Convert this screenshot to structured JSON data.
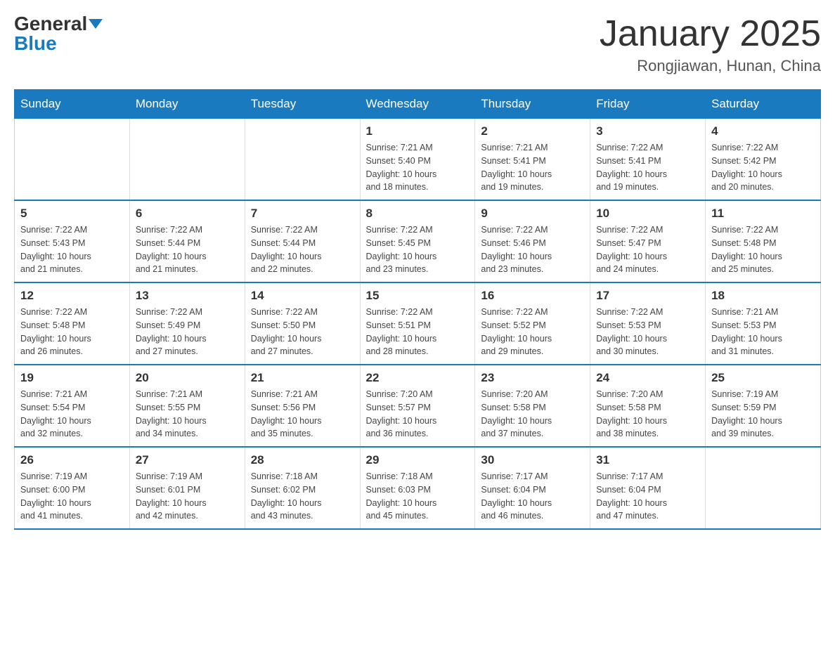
{
  "header": {
    "logo_general": "General",
    "logo_blue": "Blue",
    "title": "January 2025",
    "subtitle": "Rongjiawan, Hunan, China"
  },
  "days_of_week": [
    "Sunday",
    "Monday",
    "Tuesday",
    "Wednesday",
    "Thursday",
    "Friday",
    "Saturday"
  ],
  "weeks": [
    [
      {
        "day": "",
        "info": ""
      },
      {
        "day": "",
        "info": ""
      },
      {
        "day": "",
        "info": ""
      },
      {
        "day": "1",
        "info": "Sunrise: 7:21 AM\nSunset: 5:40 PM\nDaylight: 10 hours\nand 18 minutes."
      },
      {
        "day": "2",
        "info": "Sunrise: 7:21 AM\nSunset: 5:41 PM\nDaylight: 10 hours\nand 19 minutes."
      },
      {
        "day": "3",
        "info": "Sunrise: 7:22 AM\nSunset: 5:41 PM\nDaylight: 10 hours\nand 19 minutes."
      },
      {
        "day": "4",
        "info": "Sunrise: 7:22 AM\nSunset: 5:42 PM\nDaylight: 10 hours\nand 20 minutes."
      }
    ],
    [
      {
        "day": "5",
        "info": "Sunrise: 7:22 AM\nSunset: 5:43 PM\nDaylight: 10 hours\nand 21 minutes."
      },
      {
        "day": "6",
        "info": "Sunrise: 7:22 AM\nSunset: 5:44 PM\nDaylight: 10 hours\nand 21 minutes."
      },
      {
        "day": "7",
        "info": "Sunrise: 7:22 AM\nSunset: 5:44 PM\nDaylight: 10 hours\nand 22 minutes."
      },
      {
        "day": "8",
        "info": "Sunrise: 7:22 AM\nSunset: 5:45 PM\nDaylight: 10 hours\nand 23 minutes."
      },
      {
        "day": "9",
        "info": "Sunrise: 7:22 AM\nSunset: 5:46 PM\nDaylight: 10 hours\nand 23 minutes."
      },
      {
        "day": "10",
        "info": "Sunrise: 7:22 AM\nSunset: 5:47 PM\nDaylight: 10 hours\nand 24 minutes."
      },
      {
        "day": "11",
        "info": "Sunrise: 7:22 AM\nSunset: 5:48 PM\nDaylight: 10 hours\nand 25 minutes."
      }
    ],
    [
      {
        "day": "12",
        "info": "Sunrise: 7:22 AM\nSunset: 5:48 PM\nDaylight: 10 hours\nand 26 minutes."
      },
      {
        "day": "13",
        "info": "Sunrise: 7:22 AM\nSunset: 5:49 PM\nDaylight: 10 hours\nand 27 minutes."
      },
      {
        "day": "14",
        "info": "Sunrise: 7:22 AM\nSunset: 5:50 PM\nDaylight: 10 hours\nand 27 minutes."
      },
      {
        "day": "15",
        "info": "Sunrise: 7:22 AM\nSunset: 5:51 PM\nDaylight: 10 hours\nand 28 minutes."
      },
      {
        "day": "16",
        "info": "Sunrise: 7:22 AM\nSunset: 5:52 PM\nDaylight: 10 hours\nand 29 minutes."
      },
      {
        "day": "17",
        "info": "Sunrise: 7:22 AM\nSunset: 5:53 PM\nDaylight: 10 hours\nand 30 minutes."
      },
      {
        "day": "18",
        "info": "Sunrise: 7:21 AM\nSunset: 5:53 PM\nDaylight: 10 hours\nand 31 minutes."
      }
    ],
    [
      {
        "day": "19",
        "info": "Sunrise: 7:21 AM\nSunset: 5:54 PM\nDaylight: 10 hours\nand 32 minutes."
      },
      {
        "day": "20",
        "info": "Sunrise: 7:21 AM\nSunset: 5:55 PM\nDaylight: 10 hours\nand 34 minutes."
      },
      {
        "day": "21",
        "info": "Sunrise: 7:21 AM\nSunset: 5:56 PM\nDaylight: 10 hours\nand 35 minutes."
      },
      {
        "day": "22",
        "info": "Sunrise: 7:20 AM\nSunset: 5:57 PM\nDaylight: 10 hours\nand 36 minutes."
      },
      {
        "day": "23",
        "info": "Sunrise: 7:20 AM\nSunset: 5:58 PM\nDaylight: 10 hours\nand 37 minutes."
      },
      {
        "day": "24",
        "info": "Sunrise: 7:20 AM\nSunset: 5:58 PM\nDaylight: 10 hours\nand 38 minutes."
      },
      {
        "day": "25",
        "info": "Sunrise: 7:19 AM\nSunset: 5:59 PM\nDaylight: 10 hours\nand 39 minutes."
      }
    ],
    [
      {
        "day": "26",
        "info": "Sunrise: 7:19 AM\nSunset: 6:00 PM\nDaylight: 10 hours\nand 41 minutes."
      },
      {
        "day": "27",
        "info": "Sunrise: 7:19 AM\nSunset: 6:01 PM\nDaylight: 10 hours\nand 42 minutes."
      },
      {
        "day": "28",
        "info": "Sunrise: 7:18 AM\nSunset: 6:02 PM\nDaylight: 10 hours\nand 43 minutes."
      },
      {
        "day": "29",
        "info": "Sunrise: 7:18 AM\nSunset: 6:03 PM\nDaylight: 10 hours\nand 45 minutes."
      },
      {
        "day": "30",
        "info": "Sunrise: 7:17 AM\nSunset: 6:04 PM\nDaylight: 10 hours\nand 46 minutes."
      },
      {
        "day": "31",
        "info": "Sunrise: 7:17 AM\nSunset: 6:04 PM\nDaylight: 10 hours\nand 47 minutes."
      },
      {
        "day": "",
        "info": ""
      }
    ]
  ]
}
